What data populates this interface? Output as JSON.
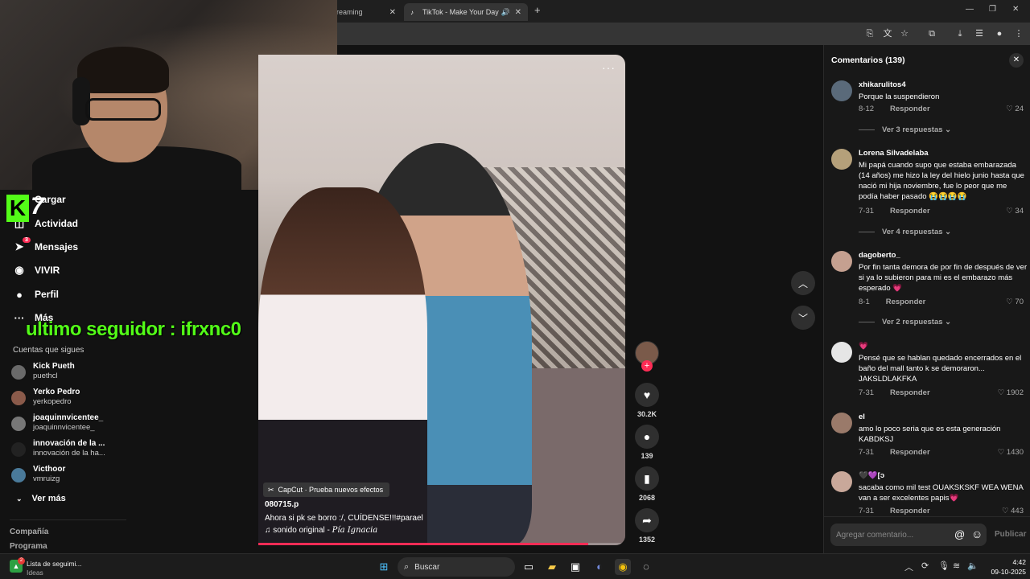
{
  "browser": {
    "tabs": [
      {
        "label": "reaming"
      },
      {
        "label": "TikTok - Make Your Day"
      }
    ],
    "new_tab": "+",
    "window_controls": [
      "—",
      "❐",
      "✕"
    ]
  },
  "stream_overlay": {
    "follower_text": "ultimo seguidor : ifrxnc0",
    "logo_letter": "K",
    "logo_number": "7"
  },
  "sidebar": {
    "nav": [
      {
        "label": "Cargar",
        "icon": "upload-icon"
      },
      {
        "label": "Actividad",
        "icon": "activity-icon"
      },
      {
        "label": "Mensajes",
        "icon": "messages-icon",
        "badge": "3"
      },
      {
        "label": "VIVIR",
        "icon": "live-icon"
      },
      {
        "label": "Perfil",
        "icon": "profile-icon"
      },
      {
        "label": "Más",
        "icon": "more-icon"
      }
    ],
    "following_header": "Cuentas que sigues",
    "following": [
      {
        "name": "Kick Pueth",
        "handle": "puethcl"
      },
      {
        "name": "Yerko Pedro",
        "handle": "yerkopedro"
      },
      {
        "name": "joaquinnvicentee_",
        "handle": "joaquinnvicentee_"
      },
      {
        "name": "innovación de la ...",
        "handle": "innovación de la ha..."
      },
      {
        "name": "Victhoor",
        "handle": "vmruizg"
      }
    ],
    "see_more": "Ver más",
    "footer": [
      "Compañía",
      "Programa"
    ]
  },
  "video": {
    "effect": "CapCut · Prueba nuevos efectos",
    "username": "080715.p",
    "description": "Ahora si pk se borro :/, CUÍDENSE!!!#parael",
    "sound_label": "sonido original - ",
    "sound_author": "Pía Ignacia",
    "progress_fraction": 0.9
  },
  "actions": {
    "likes": "30.2K",
    "comments": "139",
    "saves": "2068",
    "shares": "1352"
  },
  "comments": {
    "title": "Comentarios (139)",
    "input_placeholder": "Agregar comentario...",
    "post_label": "Publicar",
    "reply_label": "Responder",
    "items": [
      {
        "user": "xhikarulitos4",
        "text": "Porque la suspendieron",
        "date": "8-12",
        "likes": "24",
        "replies": "Ver 3 respuestas"
      },
      {
        "user": "Lorena Silvadelaba",
        "text": "Mi papá cuando supo que estaba embarazada (14 años) me hizo la ley del hielo junio hasta que nació mi hija noviembre, fue lo peor que me podía haber pasado 😭😭😭😭",
        "date": "7-31",
        "likes": "34",
        "replies": "Ver 4 respuestas"
      },
      {
        "user": "dagoberto_",
        "text": "Por fin tanta demora de por fin de después de ver si ya lo subieron para mi es el embarazo más esperado 💗",
        "date": "8-1",
        "likes": "70",
        "replies": "Ver 2 respuestas"
      },
      {
        "user": "💗",
        "text": "Pensé que se hablan quedado encerrados en el baño del mall tanto k se demoraron... JAKSLDLAKFKA",
        "date": "7-31",
        "likes": "1902",
        "replies": ""
      },
      {
        "user": "el",
        "text": "amo lo poco seria que es esta generación KABDKSJ",
        "date": "7-31",
        "likes": "1430",
        "replies": ""
      },
      {
        "user": "🖤💜[ↄ",
        "text": "sacaba como mil test OUAKSKSKF WEA WENA van a ser excelentes papis💗",
        "date": "7-31",
        "likes": "443",
        "replies": ""
      }
    ]
  },
  "taskbar": {
    "notification_title": "Lista de seguimi...",
    "notification_sub": "Ideas",
    "notification_badge": "2",
    "search_label": "Buscar",
    "time": "4:42",
    "date": "09-10-2025"
  }
}
